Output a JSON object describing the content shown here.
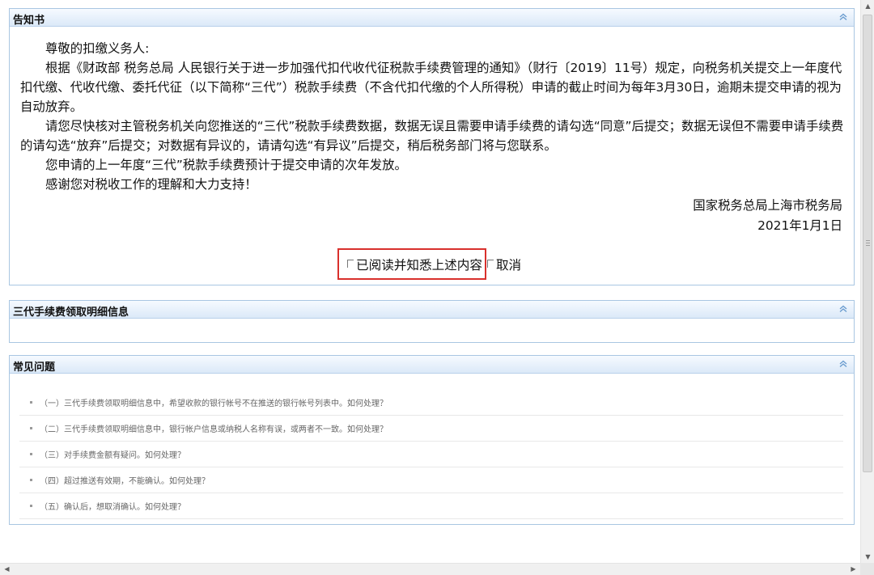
{
  "notice": {
    "title": "告知书",
    "salutation": "尊敬的扣缴义务人:",
    "paragraph1": "根据《财政部 税务总局 人民银行关于进一步加强代扣代收代征税款手续费管理的通知》（财行〔2019〕11号）规定，向税务机关提交上一年度代扣代缴、代收代缴、委托代征（以下简称“三代”）税款手续费（不含代扣代缴的个人所得税）申请的截止时间为每年3月30日，逾期未提交申请的视为自动放弃。",
    "paragraph2": "请您尽快核对主管税务机关向您推送的“三代”税款手续费数据，数据无误且需要申请手续费的请勾选“同意”后提交；数据无误但不需要申请手续费的请勾选“放弃”后提交；对数据有异议的，请请勾选“有异议”后提交，稍后税务部门将与您联系。",
    "paragraph3": "您申请的上一年度“三代”税款手续费预计于提交申请的次年发放。",
    "paragraph4": "感谢您对税收工作的理解和大力支持！",
    "signer": "国家税务总局上海市税务局",
    "date": "2021年1月1日",
    "confirm_label": "已阅读并知悉上述内容",
    "cancel_label": "取消"
  },
  "detail": {
    "title": "三代手续费领取明细信息"
  },
  "faq": {
    "title": "常见问题",
    "items": [
      "（一）三代手续费领取明细信息中，希望收款的银行帐号不在推送的银行帐号列表中。如何处理？",
      "（二）三代手续费领取明细信息中，银行帐户信息或纳税人名称有误，或两者不一致。如何处理？",
      "（三）对手续费金额有疑问。如何处理？",
      "（四）超过推送有效期，不能确认。如何处理？",
      "（五）确认后，想取消确认。如何处理？"
    ]
  },
  "colors": {
    "panel_border": "#a9c6e2",
    "header_gradient_bottom": "#dbe9f8",
    "highlight_border": "#d9302c"
  }
}
